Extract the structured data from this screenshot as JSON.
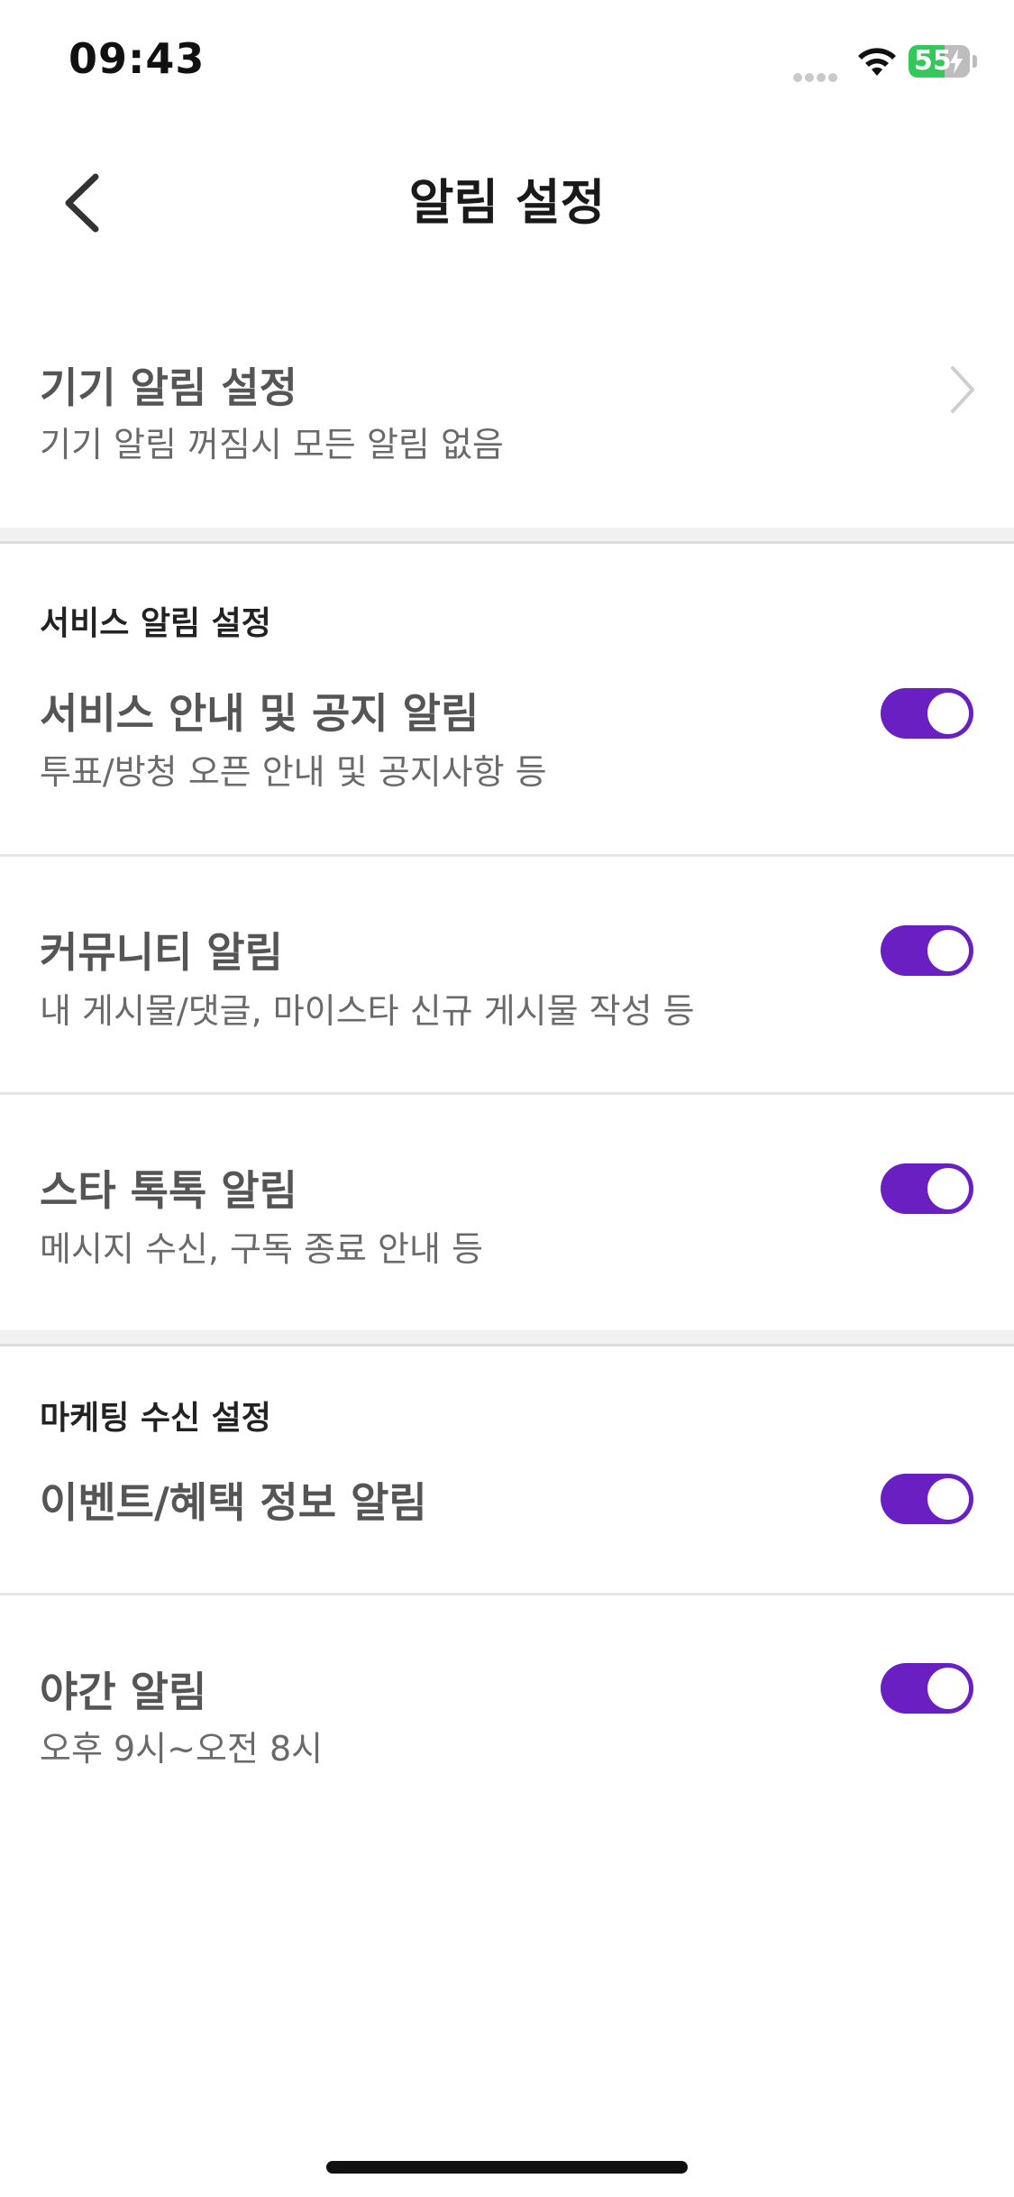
{
  "status_bar": {
    "time": "09:43",
    "battery_percent": "55"
  },
  "header": {
    "title": "알림 설정",
    "back_icon": "chevron-left-icon"
  },
  "device_alarm": {
    "title": "기기 알림 설정",
    "subtitle": "기기 알림 꺼짐시 모든 알림 없음"
  },
  "service_section": {
    "label": "서비스 알림 설정",
    "items": [
      {
        "title": "서비스 안내 및 공지 알림",
        "subtitle": "투표/방청 오픈 안내 및 공지사항 등",
        "enabled": true
      },
      {
        "title": "커뮤니티 알림",
        "subtitle": "내 게시물/댓글, 마이스타 신규 게시물 작성 등",
        "enabled": true
      },
      {
        "title": "스타 톡톡 알림",
        "subtitle": "메시지 수신, 구독 종료 안내 등",
        "enabled": true
      }
    ]
  },
  "marketing_section": {
    "label": "마케팅 수신 설정",
    "items": [
      {
        "title": "이벤트/혜택 정보 알림",
        "subtitle": "",
        "enabled": true
      },
      {
        "title": "야간 알림",
        "subtitle": "오후 9시~오전 8시",
        "enabled": true
      }
    ]
  },
  "colors": {
    "toggle_on": "#6a1fc2",
    "battery": "#34c759"
  }
}
